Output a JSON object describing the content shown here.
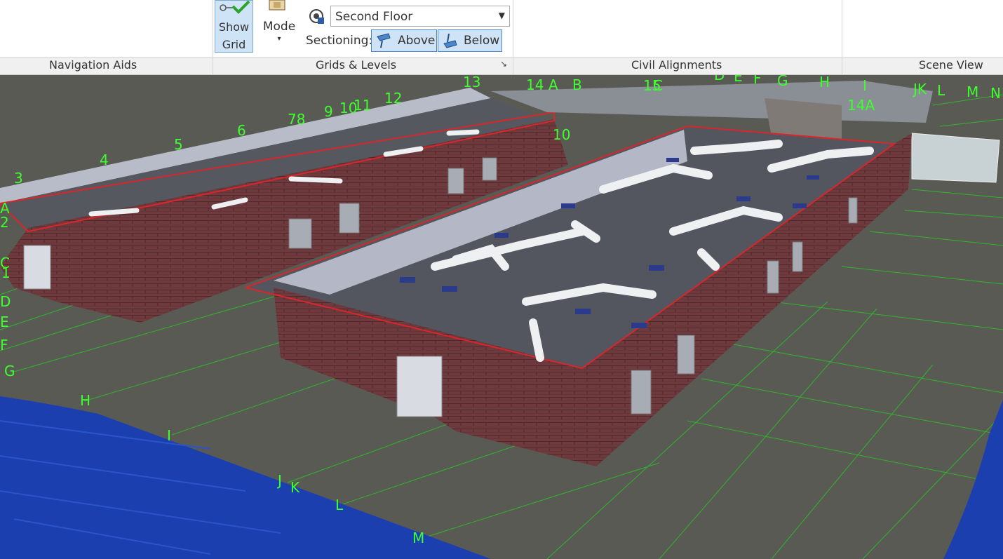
{
  "ribbon": {
    "show_grid": {
      "line1": "Show",
      "line2": "Grid"
    },
    "mode": {
      "label": "Mode",
      "arrow": "▾"
    },
    "level_select": {
      "value": "Second Floor",
      "caret": "▼"
    },
    "sectioning": {
      "label": "Sectioning:",
      "above": "Above",
      "below": "Below"
    },
    "panels": {
      "navigation_aids": "Navigation Aids",
      "grids_levels": "Grids & Levels",
      "civil_alignments": "Civil Alignments",
      "scene_view": "Scene View"
    },
    "launcher_glyph": "↘"
  },
  "grid_labels": {
    "top": [
      "3",
      "4",
      "5",
      "6",
      "78",
      "9",
      "10",
      "11",
      "12",
      "13",
      "14",
      "A",
      "B",
      "15",
      "C",
      "D",
      "E",
      "F",
      "G",
      "H",
      "I",
      "JK",
      "L",
      "M",
      "N",
      "14A",
      "10"
    ],
    "left": [
      "A",
      "2",
      "C",
      "1",
      "D",
      "E",
      "F",
      "G",
      "H",
      "I",
      "J",
      "K",
      "L",
      "M"
    ]
  },
  "colors": {
    "grid_label": "#3dff2e",
    "grid_line": "#2fb52a",
    "brick": "#6e3a3e",
    "roof_slab": "#5b5e66",
    "duct": "#eef0f2",
    "water": "#1c3fb0",
    "ground": "#5a5a55",
    "accent": "#4a86c8"
  }
}
